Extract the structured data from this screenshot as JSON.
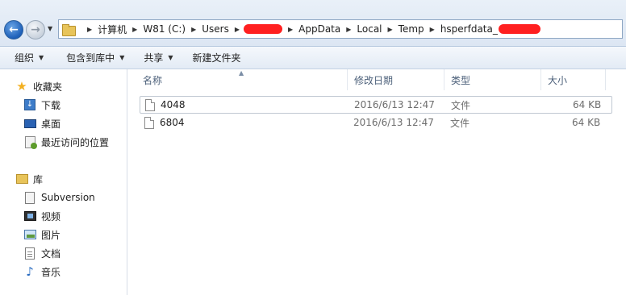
{
  "breadcrumb": {
    "items": [
      "计算机",
      "W81 (C:)",
      "Users",
      "AppData",
      "Local",
      "Temp",
      "hsperfdata_"
    ]
  },
  "toolbar": {
    "organize": "组织",
    "include_in_library": "包含到库中",
    "share": "共享",
    "new_folder": "新建文件夹"
  },
  "nav": {
    "favorites": "收藏夹",
    "downloads": "下载",
    "desktop": "桌面",
    "recent": "最近访问的位置",
    "libraries": "库",
    "subversion": "Subversion",
    "videos": "视频",
    "pictures": "图片",
    "documents": "文档",
    "music": "音乐"
  },
  "columns": {
    "name": "名称",
    "date": "修改日期",
    "type": "类型",
    "size": "大小"
  },
  "files": [
    {
      "name": "4048",
      "date": "2016/6/13 12:47",
      "type": "文件",
      "size": "64 KB"
    },
    {
      "name": "6804",
      "date": "2016/6/13 12:47",
      "type": "文件",
      "size": "64 KB"
    }
  ],
  "colors": {
    "redaction": "#ff2020",
    "header_text": "#4c607a",
    "favorites_star": "#f3b020"
  }
}
